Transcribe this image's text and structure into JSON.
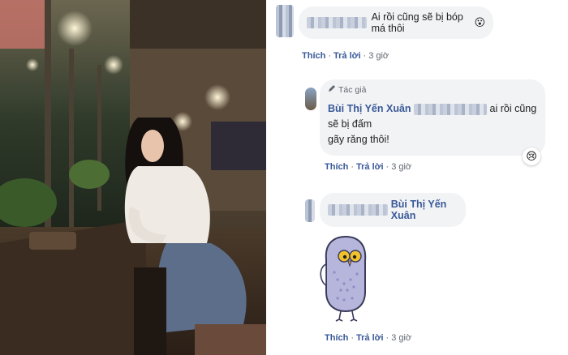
{
  "comments": [
    {
      "text": "Ai rồi cũng sẽ bị bóp má thôi",
      "emoji": "😮",
      "actions": {
        "like": "Thích",
        "reply": "Trả lời",
        "time": "3 giờ"
      }
    },
    {
      "author_tag": "Tác giả",
      "author_name": "Bùi Thị Yến Xuân",
      "text_line1": "ai rồi cũng sẽ bị đấm",
      "text_line2": "gãy răng thôi!",
      "reaction": "😢",
      "actions": {
        "like": "Thích",
        "reply": "Trả lời",
        "time": "3 giờ"
      }
    },
    {
      "mention": "Bùi Thị Yến Xuân",
      "sticker": "owl-sticker",
      "actions": {
        "like": "Thích",
        "reply": "Trả lời",
        "time": "3 giờ"
      }
    }
  ],
  "colors": {
    "link": "#385898",
    "bubble": "#f2f3f5",
    "meta": "#606770"
  }
}
